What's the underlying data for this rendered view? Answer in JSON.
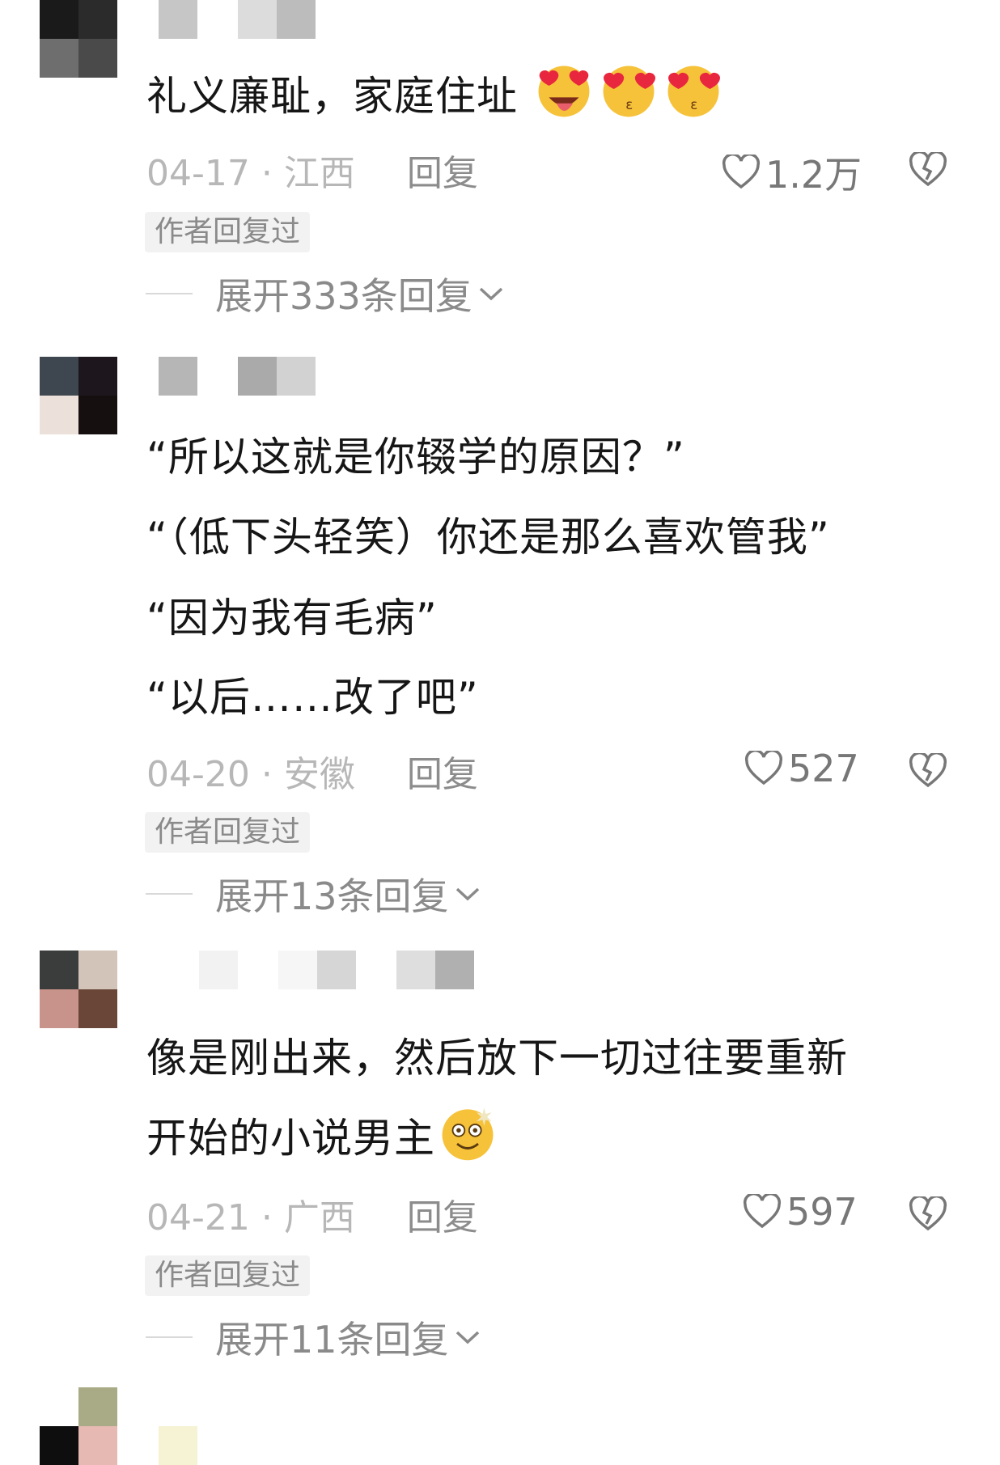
{
  "comments": [
    {
      "text_lines": [
        "礼义廉耻，家庭住址"
      ],
      "emojis": [
        "tongue-heart-eyes-emoji",
        "kiss-heart-eyes-emoji",
        "kiss-heart-eyes-emoji"
      ],
      "date": "04-17",
      "location": "江西",
      "reply_label": "回复",
      "likes": "1.2万",
      "badge": "作者回复过",
      "expand": "展开333条回复",
      "avatar_colors": [
        "#1a1a1a",
        "#2b2b2b",
        "#6e6e6e",
        "#4a4a4a"
      ]
    },
    {
      "text_lines": [
        "“所以这就是你辍学的原因？”",
        "“（低下头轻笑）你还是那么喜欢管我”",
        "“因为我有毛病”",
        "“以后……改了吧”"
      ],
      "date": "04-20",
      "location": "安徽",
      "reply_label": "回复",
      "likes": "527",
      "badge": "作者回复过",
      "expand": "展开13条回复",
      "avatar_colors": [
        "#3e4650",
        "#1d161c",
        "#ece0da",
        "#150f0f"
      ]
    },
    {
      "text_lines": [
        "像是刚出来，然后放下一切过往要重新",
        "开始的小说男主"
      ],
      "emojis": [
        "dizzy-smile-emoji"
      ],
      "date": "04-21",
      "location": "广西",
      "reply_label": "回复",
      "likes": "597",
      "badge": "作者回复过",
      "expand": "展开11条回复",
      "avatar_colors": [
        "#3b3d3c",
        "#d2c4b8",
        "#c7938a",
        "#6a4638"
      ]
    },
    {
      "avatar_colors": [
        "#ffffff",
        "#a9ab86",
        "#0e0e0e",
        "#e6b9b2"
      ]
    }
  ],
  "colors": {
    "text": "#161616",
    "meta": "#b7b7b7",
    "reply": "#8c8c8c",
    "badge_bg": "#f2f2f2"
  }
}
